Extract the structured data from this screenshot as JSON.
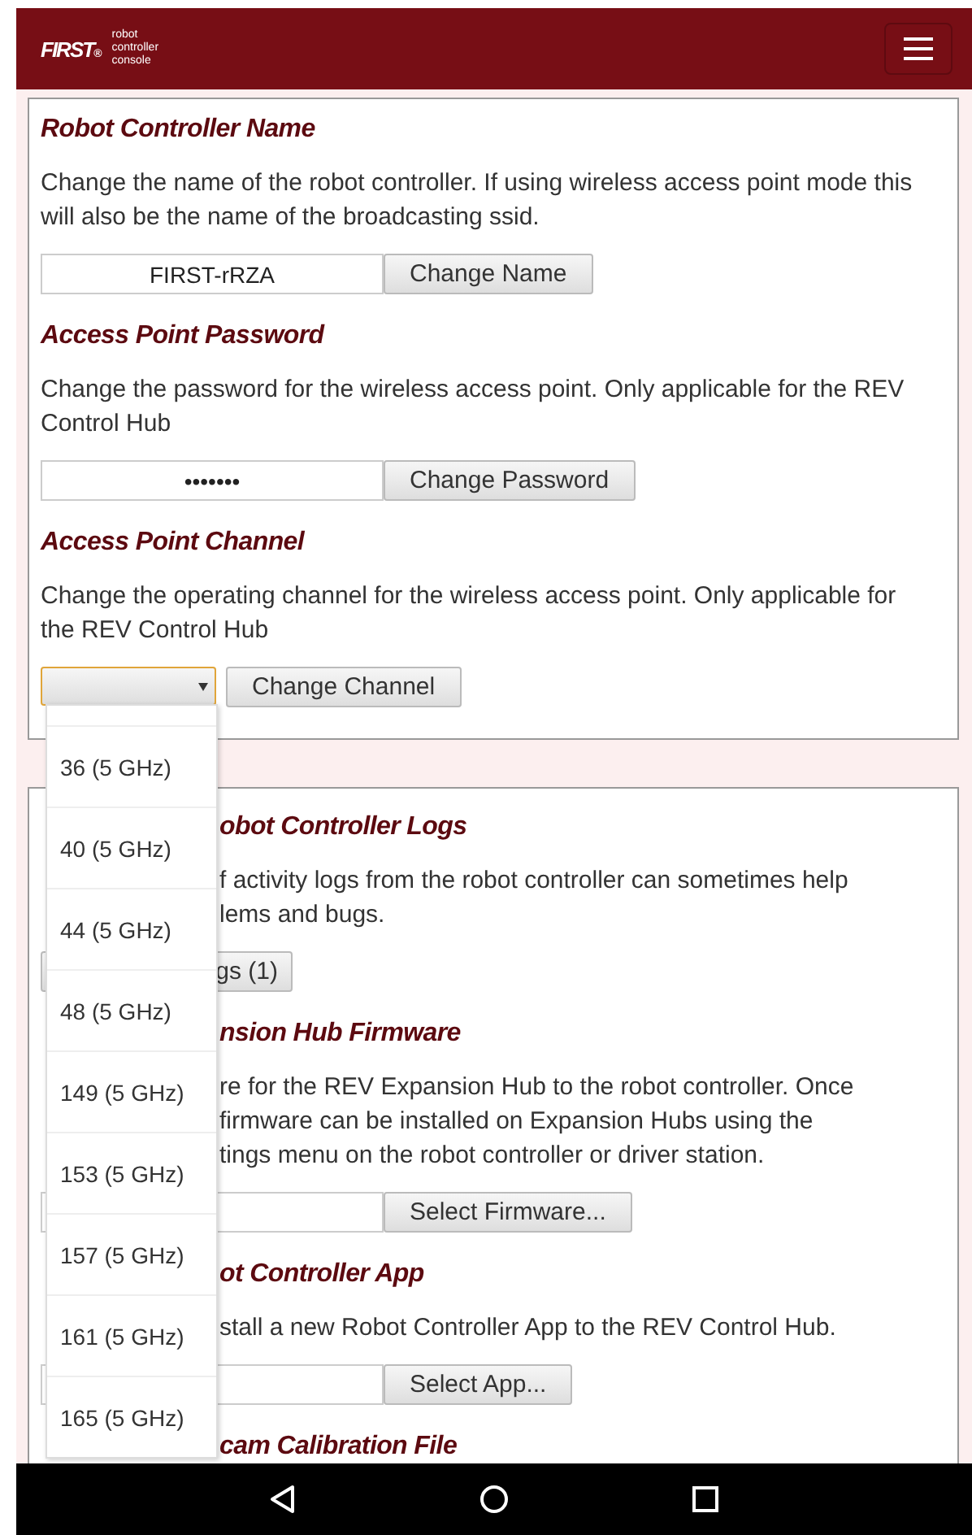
{
  "header": {
    "logo": "FIRST",
    "logo_mark": "®",
    "subtitle": [
      "robot",
      "controller",
      "console"
    ]
  },
  "settings_card": {
    "sections": [
      {
        "kind": "text",
        "title": "Robot Controller Name",
        "description": "Change the name of the robot controller. If using wireless access point mode this will also be the name of the broadcasting ssid.",
        "value": "FIRST-rRZA",
        "button": "Change Name"
      },
      {
        "kind": "text",
        "title": "Access Point Password",
        "description": "Change the password for the wireless access point. Only applicable for the REV Control Hub",
        "value": "•••••••",
        "button": "Change Password"
      },
      {
        "kind": "select",
        "title": "Access Point Channel",
        "description": "Change the operating channel for the wireless access point. Only applicable for the REV Control Hub",
        "button": "Change Channel"
      }
    ]
  },
  "channel_dropdown": {
    "options": [
      {
        "label": "36 (5 GHz)",
        "selected": false
      },
      {
        "label": "40 (5 GHz)",
        "selected": false
      },
      {
        "label": "44 (5 GHz)",
        "selected": false
      },
      {
        "label": "48 (5 GHz)",
        "selected": false
      },
      {
        "label": "149 (5 GHz)",
        "selected": false
      },
      {
        "label": "153 (5 GHz)",
        "selected": false
      },
      {
        "label": "157 (5 GHz)",
        "selected": false
      },
      {
        "label": "161 (5 GHz)",
        "selected": false
      },
      {
        "label": "165 (5 GHz)",
        "selected": false
      }
    ]
  },
  "partial_card": {
    "sections": [
      {
        "kind": "button",
        "title": "obot Controller Logs",
        "lines": [
          "f activity logs from the robot controller can sometimes help",
          "lems and bugs."
        ],
        "button": "gs (1)"
      },
      {
        "kind": "file",
        "title": "nsion Hub Firmware",
        "lines": [
          "re for the REV Expansion Hub to the robot controller. Once",
          "firmware can be installed on Expansion Hubs using the",
          "tings menu on the robot controller or driver station."
        ],
        "button": "Select Firmware..."
      },
      {
        "kind": "file",
        "title": "ot Controller App",
        "lines": [
          "stall a new Robot Controller App to the REV Control Hub."
        ],
        "button": "Select App..."
      },
      {
        "kind": "heading",
        "title": "cam Calibration File"
      }
    ]
  }
}
